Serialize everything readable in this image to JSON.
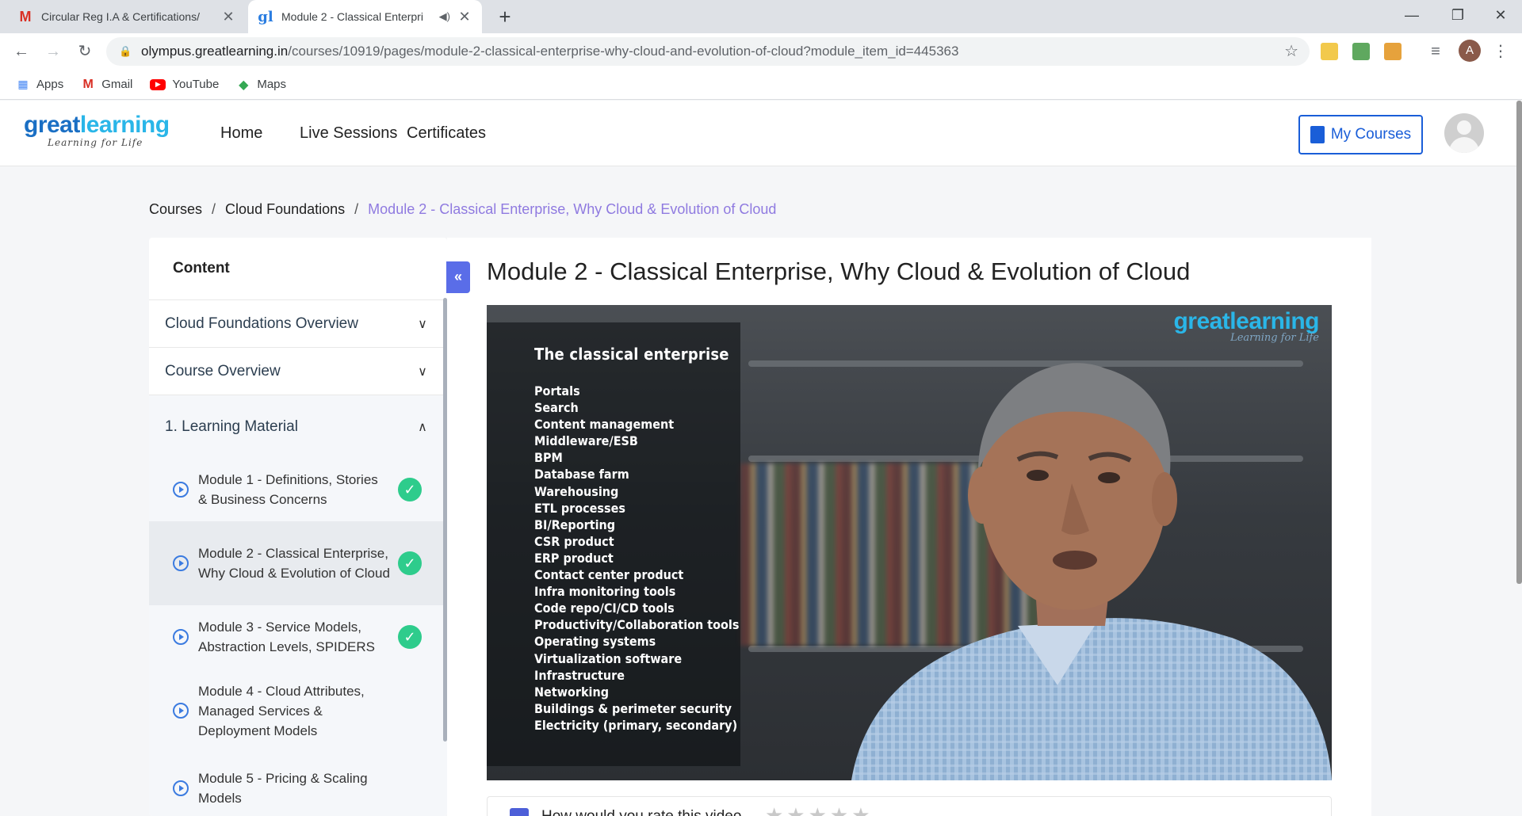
{
  "browser": {
    "tabs": [
      {
        "title": "Circular Reg I.A & Certifications/",
        "icon": "gmail-icon"
      },
      {
        "title": "Module 2 - Classical Enterpri",
        "icon": "greatlearning-icon",
        "active": true
      }
    ],
    "url_host": "olympus.greatlearning.in",
    "url_path": "/courses/10919/pages/module-2-classical-enterprise-why-cloud-and-evolution-of-cloud?module_item_id=445363",
    "profile_initial": "A",
    "bookmarks": [
      {
        "label": "Apps",
        "icon": "apps-grid-icon"
      },
      {
        "label": "Gmail",
        "icon": "gmail-icon"
      },
      {
        "label": "YouTube",
        "icon": "youtube-icon"
      },
      {
        "label": "Maps",
        "icon": "maps-icon"
      }
    ]
  },
  "site": {
    "logo_word_a": "great",
    "logo_word_b": "learning",
    "logo_tag": "Learning for Life",
    "nav": [
      "Home",
      "Live Sessions",
      "Certificates"
    ],
    "my_courses": "My Courses"
  },
  "breadcrumb": {
    "items": [
      "Courses",
      "Cloud Foundations"
    ],
    "current": "Module 2 - Classical Enterprise, Why Cloud & Evolution of Cloud"
  },
  "sidebar": {
    "heading": "Content",
    "sections": [
      {
        "label": "Cloud Foundations Overview",
        "open": false
      },
      {
        "label": "Course Overview",
        "open": false
      },
      {
        "label": "1. Learning Material",
        "open": true
      }
    ],
    "modules": [
      {
        "label": "Module 1 - Definitions, Stories & Business Concerns",
        "done": true
      },
      {
        "label": "Module 2 - Classical Enterprise, Why Cloud & Evolution of Cloud",
        "done": true,
        "selected": true
      },
      {
        "label": "Module 3 - Service Models, Abstraction Levels, SPIDERS",
        "done": true
      },
      {
        "label": "Module 4 - Cloud Attributes, Managed Services & Deployment Models",
        "done": false
      },
      {
        "label": "Module 5 - Pricing & Scaling Models",
        "done": false
      }
    ]
  },
  "main": {
    "title": "Module 2 - Classical Enterprise, Why Cloud & Evolution of Cloud",
    "video": {
      "slide_title": "The classical enterprise",
      "slide_items": [
        "Portals",
        "Search",
        "Content management",
        "Middleware/ESB",
        "BPM",
        "Database farm",
        "Warehousing",
        "ETL processes",
        "BI/Reporting",
        "CSR product",
        "ERP product",
        "Contact center product",
        "Infra monitoring tools",
        "Code repo/CI/CD tools",
        "Productivity/Collaboration tools",
        "Operating systems",
        "Virtualization software",
        "Infrastructure",
        "Networking",
        "Buildings & perimeter security",
        "Electricity (primary, secondary)"
      ],
      "watermark_word_a": "great",
      "watermark_word_b": "learning",
      "watermark_tag": "Learning for Life"
    },
    "rating_question": "How would you rate this video"
  },
  "colors": {
    "accent": "#1a5ed8",
    "breadcrumb_current": "#8f7ae0",
    "check": "#2ecc8c",
    "collapse": "#5a6de8"
  }
}
